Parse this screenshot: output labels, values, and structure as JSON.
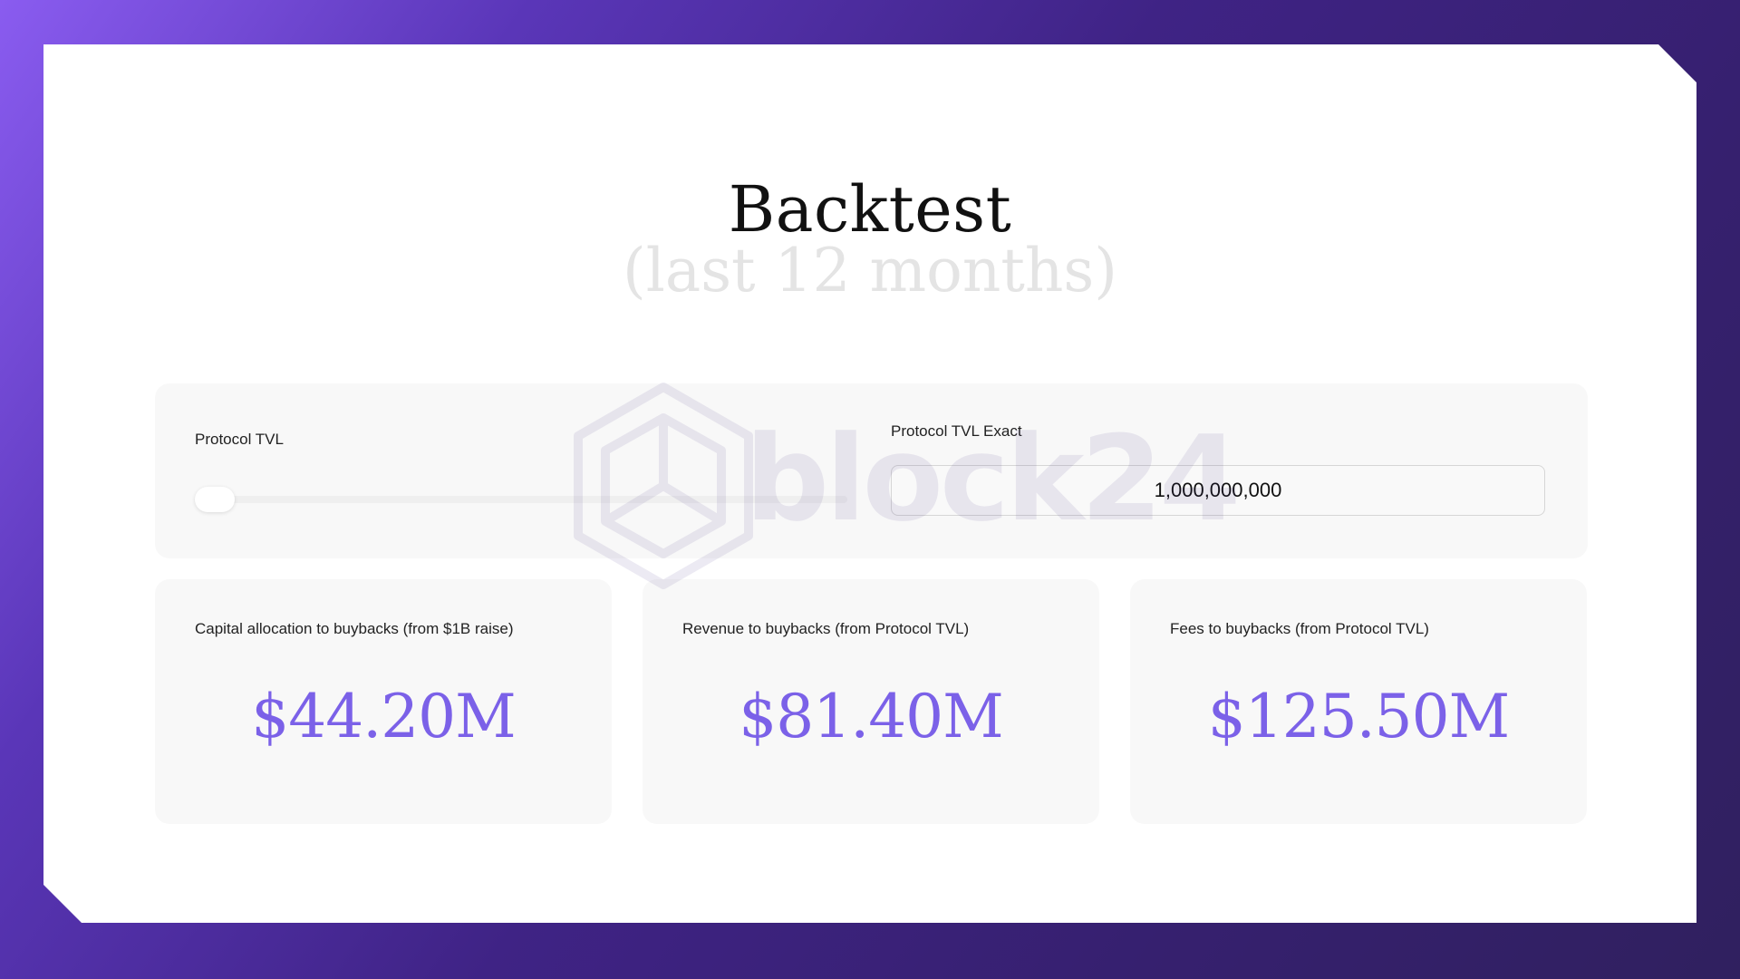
{
  "page": {
    "title": "Backtest",
    "subtitle": "(last 12 months)"
  },
  "controls": {
    "slider_label": "Protocol TVL",
    "slider_level": 0.0,
    "exact_label": "Protocol TVL Exact",
    "exact_value": "1,000,000,000"
  },
  "metrics": [
    {
      "label": "Capital allocation to buybacks (from $1B raise)",
      "value": "$44.20M"
    },
    {
      "label": "Revenue to buybacks (from Protocol TVL)",
      "value": "$81.40M"
    },
    {
      "label": "Fees to buybacks (from Protocol TVL)",
      "value": "$125.50M"
    }
  ],
  "watermark": {
    "text": "block24",
    "icon": "cube-logo-icon"
  },
  "colors": {
    "accent": "#7b61e8",
    "background_gradient_start": "#8a5cf0",
    "background_gradient_end": "#30205f",
    "panel": "#f8f8f8"
  }
}
